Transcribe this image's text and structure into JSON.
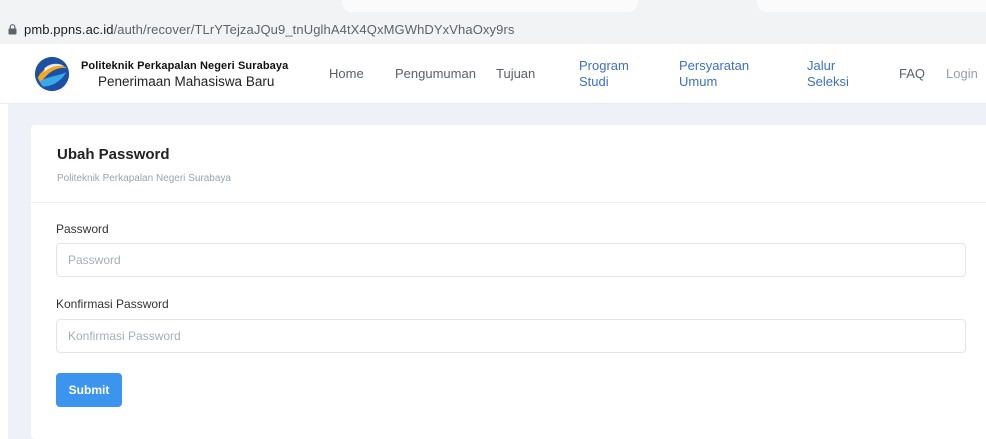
{
  "browser": {
    "url_host": "pmb.ppns.ac.id",
    "url_path": "/auth/recover/TLrYTejzaJQu9_tnUglhA4tX4QxMGWhDYxVhaOxy9rs"
  },
  "brand": {
    "title": "Politeknik Perkapalan Negeri Surabaya",
    "subtitle": "Penerimaan Mahasiswa Baru"
  },
  "nav": {
    "home": "Home",
    "pengumuman": "Pengumuman",
    "tujuan": "Tujuan",
    "program_1": "Program",
    "program_2": "Studi",
    "persyaratan_1": "Persyaratan",
    "persyaratan_2": "Umum",
    "jalur_1": "Jalur",
    "jalur_2": "Seleksi",
    "faq": "FAQ",
    "login": "Login"
  },
  "card": {
    "title": "Ubah Password",
    "subtitle": "Politeknik Perkapalan Negeri Surabaya"
  },
  "form": {
    "password_label": "Password",
    "password_placeholder": "Password",
    "confirm_label": "Konfirmasi Password",
    "confirm_placeholder": "Konfirmasi Password",
    "submit_label": "Submit"
  },
  "colors": {
    "accent_button": "#3b95ee",
    "nav_link_blue": "#3d6fcf",
    "page_background": "#eef1f7"
  }
}
